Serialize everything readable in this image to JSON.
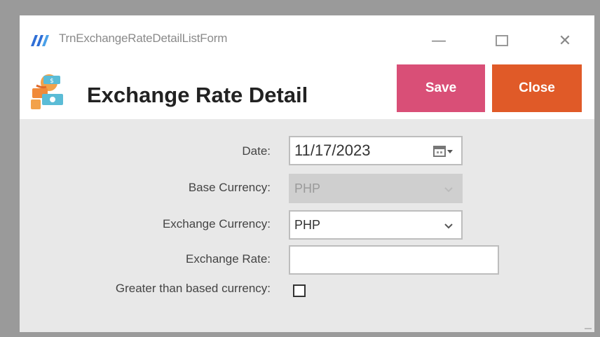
{
  "window": {
    "title": "TrnExchangeRateDetailListForm",
    "controls": {
      "minimize": "—",
      "maximize": "",
      "close": "✕"
    }
  },
  "header": {
    "title": "Exchange Rate Detail",
    "save_label": "Save",
    "close_label": "Close"
  },
  "form": {
    "date_label": "Date:",
    "date_value": "11/17/2023",
    "base_currency_label": "Base Currency:",
    "base_currency_value": "PHP",
    "exchange_currency_label": "Exchange Currency:",
    "exchange_currency_value": "PHP",
    "exchange_rate_label": "Exchange Rate:",
    "exchange_rate_value": "",
    "greater_label": "Greater than based currency:",
    "greater_checked": false
  },
  "colors": {
    "save": "#d94f77",
    "close": "#e05a28",
    "body_bg": "#e8e8e8"
  },
  "icons": {
    "app": "app-logo-icon",
    "form": "exchange-money-icon",
    "calendar": "calendar-icon",
    "dropdown": "chevron-down-icon"
  }
}
